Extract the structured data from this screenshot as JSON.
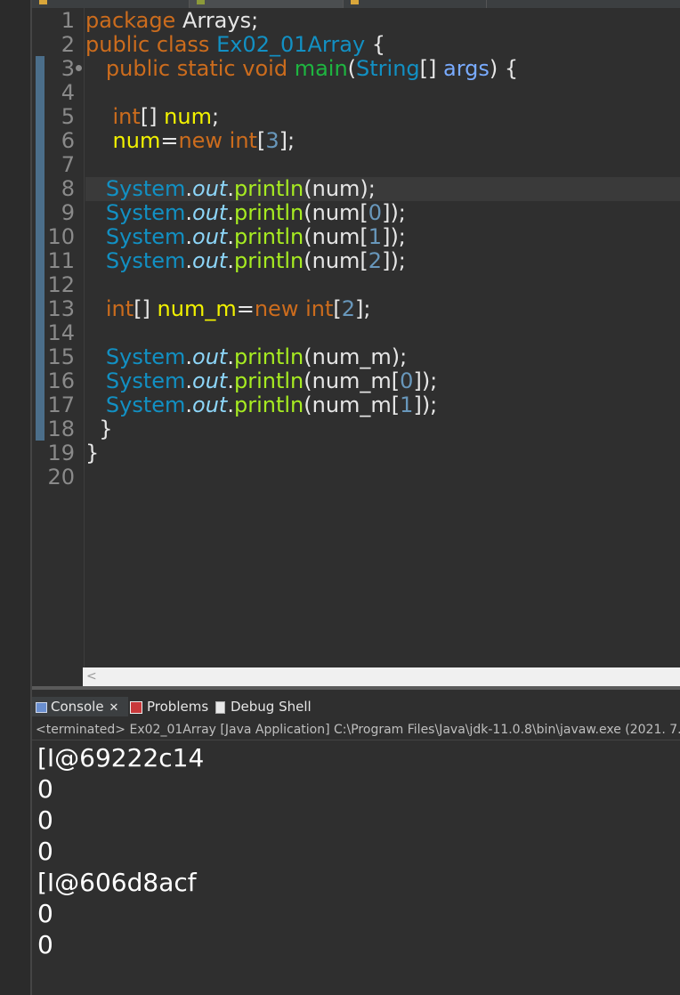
{
  "editor": {
    "line_numbers": [
      "1",
      "2",
      "3",
      "4",
      "5",
      "6",
      "7",
      "8",
      "9",
      "10",
      "11",
      "12",
      "13",
      "14",
      "15",
      "16",
      "17",
      "18",
      "19",
      "20"
    ],
    "lines": [
      [
        {
          "t": "package ",
          "c": "k"
        },
        {
          "t": "Arrays;",
          "c": "pl"
        }
      ],
      [
        {
          "t": "public ",
          "c": "k"
        },
        {
          "t": "class ",
          "c": "k"
        },
        {
          "t": "Ex02_01Array",
          "c": "cls"
        },
        {
          "t": " {",
          "c": "pl"
        }
      ],
      [
        {
          "t": "   public ",
          "c": "k"
        },
        {
          "t": "static ",
          "c": "k"
        },
        {
          "t": "void ",
          "c": "k"
        },
        {
          "t": "main",
          "c": "m"
        },
        {
          "t": "(",
          "c": "pl"
        },
        {
          "t": "String",
          "c": "ty"
        },
        {
          "t": "[] ",
          "c": "pl"
        },
        {
          "t": "args",
          "c": "p"
        },
        {
          "t": ") {",
          "c": "pl"
        }
      ],
      [],
      [
        {
          "t": "    int",
          "c": "k"
        },
        {
          "t": "[] ",
          "c": "pl"
        },
        {
          "t": "num",
          "c": "id"
        },
        {
          "t": ";",
          "c": "pl"
        }
      ],
      [
        {
          "t": "    num",
          "c": "id"
        },
        {
          "t": "=",
          "c": "pl"
        },
        {
          "t": "new ",
          "c": "k"
        },
        {
          "t": "int",
          "c": "k"
        },
        {
          "t": "[",
          "c": "pl"
        },
        {
          "t": "3",
          "c": "n"
        },
        {
          "t": "];",
          "c": "pl"
        }
      ],
      [],
      [
        {
          "t": "   System",
          "c": "cls"
        },
        {
          "t": ".",
          "c": "pl"
        },
        {
          "t": "out",
          "c": "out"
        },
        {
          "t": ".",
          "c": "pl"
        },
        {
          "t": "println",
          "c": "fn"
        },
        {
          "t": "(num);",
          "c": "pl"
        }
      ],
      [
        {
          "t": "   System",
          "c": "cls"
        },
        {
          "t": ".",
          "c": "pl"
        },
        {
          "t": "out",
          "c": "out"
        },
        {
          "t": ".",
          "c": "pl"
        },
        {
          "t": "println",
          "c": "fn"
        },
        {
          "t": "(num[",
          "c": "pl"
        },
        {
          "t": "0",
          "c": "n"
        },
        {
          "t": "]);",
          "c": "pl"
        }
      ],
      [
        {
          "t": "   System",
          "c": "cls"
        },
        {
          "t": ".",
          "c": "pl"
        },
        {
          "t": "out",
          "c": "out"
        },
        {
          "t": ".",
          "c": "pl"
        },
        {
          "t": "println",
          "c": "fn"
        },
        {
          "t": "(num[",
          "c": "pl"
        },
        {
          "t": "1",
          "c": "n"
        },
        {
          "t": "]);",
          "c": "pl"
        }
      ],
      [
        {
          "t": "   System",
          "c": "cls"
        },
        {
          "t": ".",
          "c": "pl"
        },
        {
          "t": "out",
          "c": "out"
        },
        {
          "t": ".",
          "c": "pl"
        },
        {
          "t": "println",
          "c": "fn"
        },
        {
          "t": "(num[",
          "c": "pl"
        },
        {
          "t": "2",
          "c": "n"
        },
        {
          "t": "]);",
          "c": "pl"
        }
      ],
      [],
      [
        {
          "t": "   int",
          "c": "k"
        },
        {
          "t": "[] ",
          "c": "pl"
        },
        {
          "t": "num_m",
          "c": "id"
        },
        {
          "t": "=",
          "c": "pl"
        },
        {
          "t": "new ",
          "c": "k"
        },
        {
          "t": "int",
          "c": "k"
        },
        {
          "t": "[",
          "c": "pl"
        },
        {
          "t": "2",
          "c": "n"
        },
        {
          "t": "];",
          "c": "pl"
        }
      ],
      [],
      [
        {
          "t": "   System",
          "c": "cls"
        },
        {
          "t": ".",
          "c": "pl"
        },
        {
          "t": "out",
          "c": "out"
        },
        {
          "t": ".",
          "c": "pl"
        },
        {
          "t": "println",
          "c": "fn"
        },
        {
          "t": "(num_m);",
          "c": "pl"
        }
      ],
      [
        {
          "t": "   System",
          "c": "cls"
        },
        {
          "t": ".",
          "c": "pl"
        },
        {
          "t": "out",
          "c": "out"
        },
        {
          "t": ".",
          "c": "pl"
        },
        {
          "t": "println",
          "c": "fn"
        },
        {
          "t": "(num_m[",
          "c": "pl"
        },
        {
          "t": "0",
          "c": "n"
        },
        {
          "t": "]);",
          "c": "pl"
        }
      ],
      [
        {
          "t": "   System",
          "c": "cls"
        },
        {
          "t": ".",
          "c": "pl"
        },
        {
          "t": "out",
          "c": "out"
        },
        {
          "t": ".",
          "c": "pl"
        },
        {
          "t": "println",
          "c": "fn"
        },
        {
          "t": "(num_m[",
          "c": "pl"
        },
        {
          "t": "1",
          "c": "n"
        },
        {
          "t": "]);",
          "c": "pl"
        }
      ],
      [
        {
          "t": "  }",
          "c": "pl"
        }
      ],
      [
        {
          "t": "}",
          "c": "pl"
        }
      ],
      []
    ],
    "current_line": 8
  },
  "console": {
    "tabs": {
      "console": "Console",
      "close": "✕",
      "problems": "Problems",
      "debug_shell": "Debug Shell"
    },
    "status": "<terminated> Ex02_01Array [Java Application] C:\\Program Files\\Java\\jdk-11.0.8\\bin\\javaw.exe  (2021. 7.",
    "output": [
      "[I@69222c14",
      "0",
      "0",
      "0",
      "[I@606d8acf",
      "0",
      "0"
    ]
  },
  "colors": {
    "background": "#2f2f2f",
    "keyword": "#cc6c1d",
    "class": "#1290c3",
    "method_decl": "#1eb540",
    "local_var": "#f2f200",
    "param": "#79abff",
    "static_field": "#8dd6f9",
    "method_call": "#a7ec21",
    "number": "#6897bb"
  }
}
